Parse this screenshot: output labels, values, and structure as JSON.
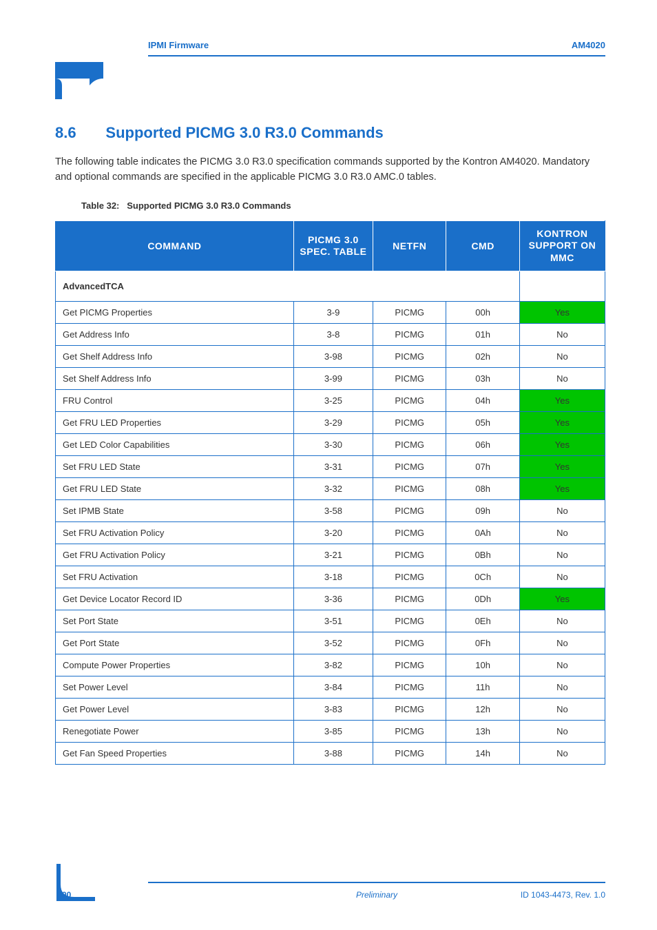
{
  "header": {
    "running_head_left": "IPMI Firmware",
    "running_head_right": "AM4020"
  },
  "section": {
    "number": "8.6",
    "title": "Supported PICMG 3.0 R3.0 Commands"
  },
  "intro": "The following table indicates the PICMG 3.0 R3.0 specification commands supported by the Kontron AM4020. Mandatory and optional commands are specified in the applicable PICMG 3.0 R3.0 AMC.0 tables.",
  "table": {
    "caption_prefix": "Table 32:",
    "caption_text": "Supported PICMG 3.0 R3.0 Commands",
    "headers": {
      "command": "COMMAND",
      "spec_table": "PICMG 3.0 SPEC. TABLE",
      "netfn": "NETFN",
      "cmd": "CMD",
      "support": "KONTRON SUPPORT ON MMC"
    },
    "section_label": "AdvancedTCA",
    "rows": [
      {
        "command": "Get PICMG Properties",
        "spec_table": "3-9",
        "netfn": "PICMG",
        "cmd": "00h",
        "support": "Yes"
      },
      {
        "command": "Get Address Info",
        "spec_table": "3-8",
        "netfn": "PICMG",
        "cmd": "01h",
        "support": "No"
      },
      {
        "command": "Get Shelf Address Info",
        "spec_table": "3-98",
        "netfn": "PICMG",
        "cmd": "02h",
        "support": "No"
      },
      {
        "command": "Set Shelf Address Info",
        "spec_table": "3-99",
        "netfn": "PICMG",
        "cmd": "03h",
        "support": "No"
      },
      {
        "command": "FRU Control",
        "spec_table": "3-25",
        "netfn": "PICMG",
        "cmd": "04h",
        "support": "Yes"
      },
      {
        "command": "Get FRU LED Properties",
        "spec_table": "3-29",
        "netfn": "PICMG",
        "cmd": "05h",
        "support": "Yes"
      },
      {
        "command": "Get LED Color Capabilities",
        "spec_table": "3-30",
        "netfn": "PICMG",
        "cmd": "06h",
        "support": "Yes"
      },
      {
        "command": "Set FRU LED State",
        "spec_table": "3-31",
        "netfn": "PICMG",
        "cmd": "07h",
        "support": "Yes"
      },
      {
        "command": "Get FRU LED State",
        "spec_table": "3-32",
        "netfn": "PICMG",
        "cmd": "08h",
        "support": "Yes"
      },
      {
        "command": "Set IPMB State",
        "spec_table": "3-58",
        "netfn": "PICMG",
        "cmd": "09h",
        "support": "No"
      },
      {
        "command": "Set FRU Activation Policy",
        "spec_table": "3-20",
        "netfn": "PICMG",
        "cmd": "0Ah",
        "support": "No"
      },
      {
        "command": "Get FRU Activation Policy",
        "spec_table": "3-21",
        "netfn": "PICMG",
        "cmd": "0Bh",
        "support": "No"
      },
      {
        "command": "Set FRU Activation",
        "spec_table": "3-18",
        "netfn": "PICMG",
        "cmd": "0Ch",
        "support": "No"
      },
      {
        "command": "Get Device Locator Record ID",
        "spec_table": "3-36",
        "netfn": "PICMG",
        "cmd": "0Dh",
        "support": "Yes"
      },
      {
        "command": "Set Port State",
        "spec_table": "3-51",
        "netfn": "PICMG",
        "cmd": "0Eh",
        "support": "No"
      },
      {
        "command": "Get Port State",
        "spec_table": "3-52",
        "netfn": "PICMG",
        "cmd": "0Fh",
        "support": "No"
      },
      {
        "command": "Compute Power Properties",
        "spec_table": "3-82",
        "netfn": "PICMG",
        "cmd": "10h",
        "support": "No"
      },
      {
        "command": "Set Power Level",
        "spec_table": "3-84",
        "netfn": "PICMG",
        "cmd": "11h",
        "support": "No"
      },
      {
        "command": "Get Power Level",
        "spec_table": "3-83",
        "netfn": "PICMG",
        "cmd": "12h",
        "support": "No"
      },
      {
        "command": "Renegotiate Power",
        "spec_table": "3-85",
        "netfn": "PICMG",
        "cmd": "13h",
        "support": "No"
      },
      {
        "command": "Get Fan Speed Properties",
        "spec_table": "3-88",
        "netfn": "PICMG",
        "cmd": "14h",
        "support": "No"
      }
    ]
  },
  "footer": {
    "page_no": "90",
    "center": "Preliminary",
    "right": "ID 1043-4473, Rev. 1.0"
  }
}
